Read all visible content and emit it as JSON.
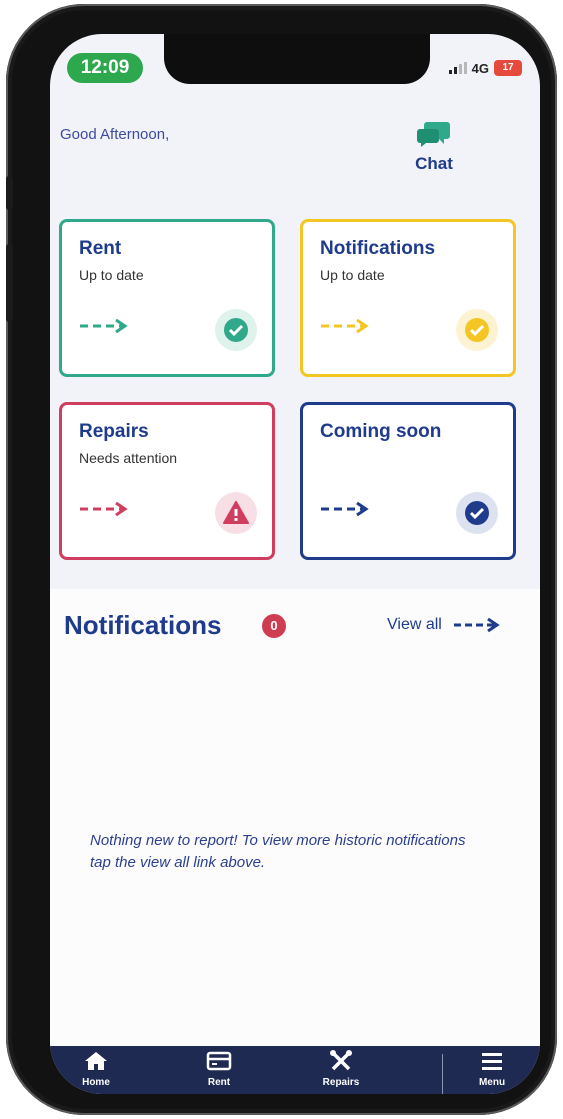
{
  "status_bar": {
    "time": "12:09",
    "network": "4G",
    "battery": "17"
  },
  "header": {
    "greeting": "Good Afternoon,",
    "chat_label": "Chat"
  },
  "cards": [
    {
      "title": "Rent",
      "subtitle": "Up to date",
      "accent": "#2fa98a",
      "status_icon": "check-circle-icon"
    },
    {
      "title": "Notifications",
      "subtitle": "Up to date",
      "accent": "#f3c623",
      "status_icon": "check-circle-icon"
    },
    {
      "title": "Repairs",
      "subtitle": "Needs attention",
      "accent": "#cf3d5f",
      "status_icon": "warning-icon"
    },
    {
      "title": "Coming soon",
      "subtitle": "",
      "accent": "#1f3b8c",
      "status_icon": "check-circle-icon"
    }
  ],
  "notifications": {
    "heading": "Notifications",
    "count": "0",
    "view_all_label": "View all",
    "empty_message": "Nothing new to report! To view more historic notifications tap the view all link above."
  },
  "tab_bar": [
    {
      "label": "Home",
      "icon": "home-icon"
    },
    {
      "label": "Rent",
      "icon": "card-icon"
    },
    {
      "label": "Repairs",
      "icon": "tools-icon"
    },
    {
      "label": "Menu",
      "icon": "menu-icon"
    }
  ],
  "colors": {
    "brand_navy": "#1f3b8c",
    "tabbar": "#1e2a52",
    "time_pill": "#2ea84f",
    "badge": "#cf3d52"
  }
}
